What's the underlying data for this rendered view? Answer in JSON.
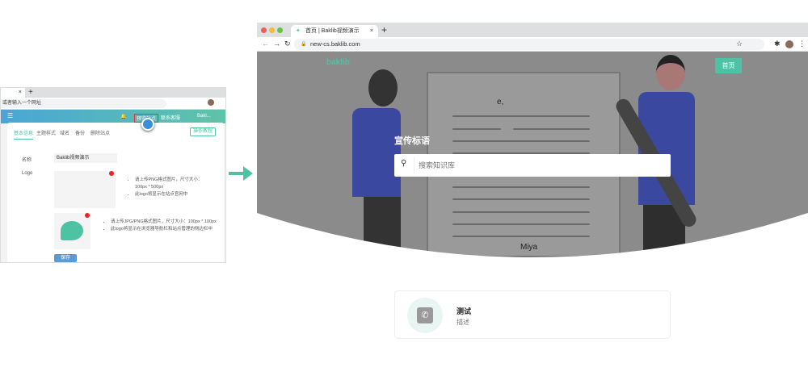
{
  "left_screenshot": {
    "address_placeholder": "或者输入一个网址",
    "header": {
      "buttons": [
        "预览站点",
        "联系客服"
      ],
      "user": "Bakl..."
    },
    "tabs": [
      "基本信息",
      "主题样式",
      "域名",
      "备份",
      "删除站点"
    ],
    "help_button": "操作教程",
    "form": {
      "name_label": "名称",
      "name_value": "Baklib视频演示",
      "logo_label": "Logo",
      "logo_text": "baklib",
      "logo_tips": [
        "请上传PNG格式图片，尺寸大小：100px * 500px",
        "此logo将显示在站点官网中"
      ],
      "favicon_tips": [
        "请上传JPG/PNG格式图片，尺寸大小：100px * 100px",
        "此logo将显示在浏览器导航栏和站点管理的侧边栏中"
      ],
      "save_button": "保存"
    }
  },
  "right_screenshot": {
    "tab_title": "首页 | Baklib视频演示",
    "url": "new-cs.baklib.com",
    "logo_text": "baklib",
    "nav_button": "首页",
    "slogan": "宣传标语",
    "search_placeholder": "搜索知识库",
    "illustration_text": [
      "e,",
      "Miya"
    ],
    "card": {
      "title": "测试",
      "description": "描述",
      "icon": "phone-icon"
    }
  },
  "colors": {
    "accent": "#4ec3a4",
    "header_blue": "#4aa6d6",
    "hero_overlay": "#8b8b8b"
  }
}
